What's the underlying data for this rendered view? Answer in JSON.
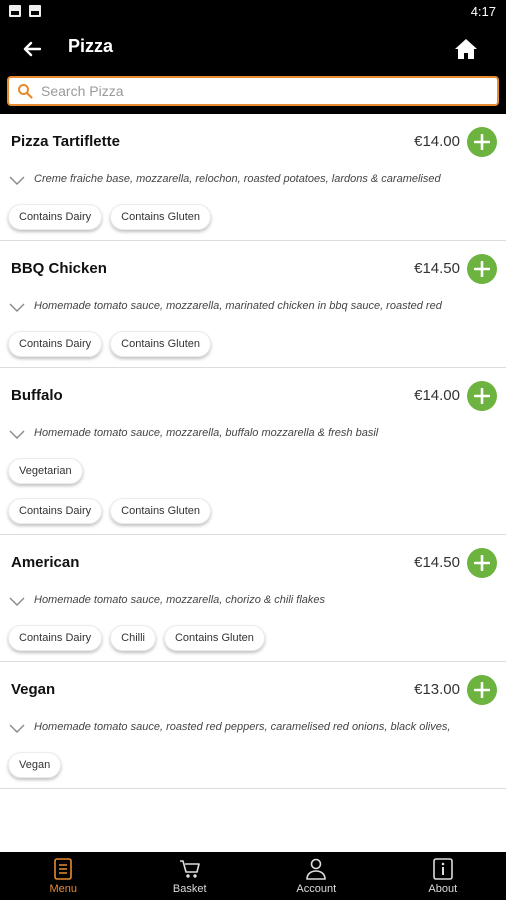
{
  "status": {
    "time": "4:17"
  },
  "header": {
    "title": "Pizza"
  },
  "search": {
    "placeholder": "Search Pizza"
  },
  "colors": {
    "accent": "#e88a2f",
    "add_button": "#6cb33f",
    "bar": "#000000"
  },
  "items": [
    {
      "name": "Pizza Tartiflette",
      "price": "€14.00",
      "description": "Creme fraiche base, mozzarella, relochon, roasted potatoes, lardons & caramelised",
      "tag_rows": [
        [
          "Contains Dairy",
          "Contains Gluten"
        ]
      ]
    },
    {
      "name": "BBQ Chicken",
      "price": "€14.50",
      "description": "Homemade tomato sauce, mozzarella, marinated chicken in bbq sauce, roasted red",
      "tag_rows": [
        [
          "Contains Dairy",
          "Contains Gluten"
        ]
      ]
    },
    {
      "name": "Buffalo",
      "price": "€14.00",
      "description": "Homemade tomato sauce, mozzarella, buffalo mozzarella & fresh basil",
      "tag_rows": [
        [
          "Vegetarian"
        ],
        [
          "Contains Dairy",
          "Contains Gluten"
        ]
      ]
    },
    {
      "name": "American",
      "price": "€14.50",
      "description": "Homemade tomato sauce, mozzarella, chorizo & chili flakes",
      "tag_rows": [
        [
          "Contains Dairy",
          "Chilli",
          "Contains Gluten"
        ]
      ]
    },
    {
      "name": "Vegan",
      "price": "€13.00",
      "description": "Homemade tomato sauce, roasted red peppers, caramelised red onions, black olives,",
      "tag_rows": [
        [
          "Vegan"
        ]
      ]
    }
  ],
  "tabs": [
    {
      "label": "Menu",
      "icon": "menu-icon",
      "active": true
    },
    {
      "label": "Basket",
      "icon": "basket-icon",
      "active": false
    },
    {
      "label": "Account",
      "icon": "account-icon",
      "active": false
    },
    {
      "label": "About",
      "icon": "about-icon",
      "active": false
    }
  ]
}
